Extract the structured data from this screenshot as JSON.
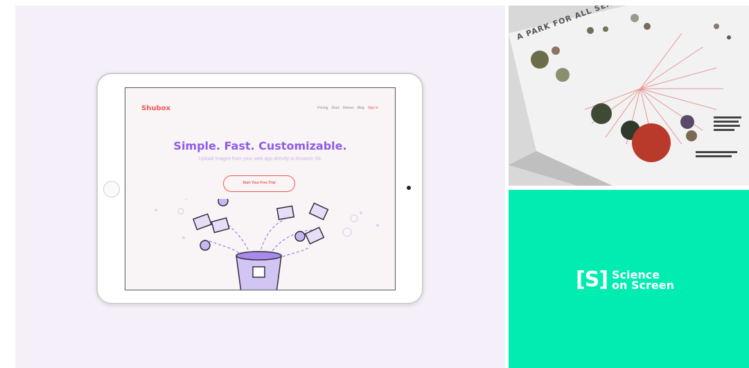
{
  "shubox": {
    "brand": "Shubox",
    "nav": [
      "Pricing",
      "Docs",
      "Demos",
      "Blog"
    ],
    "signin": "Sign in",
    "headline": "Simple. Fast. Customizable.",
    "subhead": "Upload images from your web app directly to Amazon S3.",
    "cta": "Start Your Free Trial",
    "colors": {
      "accent": "#f2584f",
      "purple": "#8e5ce8",
      "screen_bg": "#f9f4f6",
      "panel_bg": "#f4eff8"
    }
  },
  "magazine": {
    "title": "A PARK FOR ALL SEASONS"
  },
  "science_on_screen": {
    "mark": "[S]",
    "line1": "Science",
    "line2": "on Screen",
    "bg_color": "#00ecb0"
  }
}
